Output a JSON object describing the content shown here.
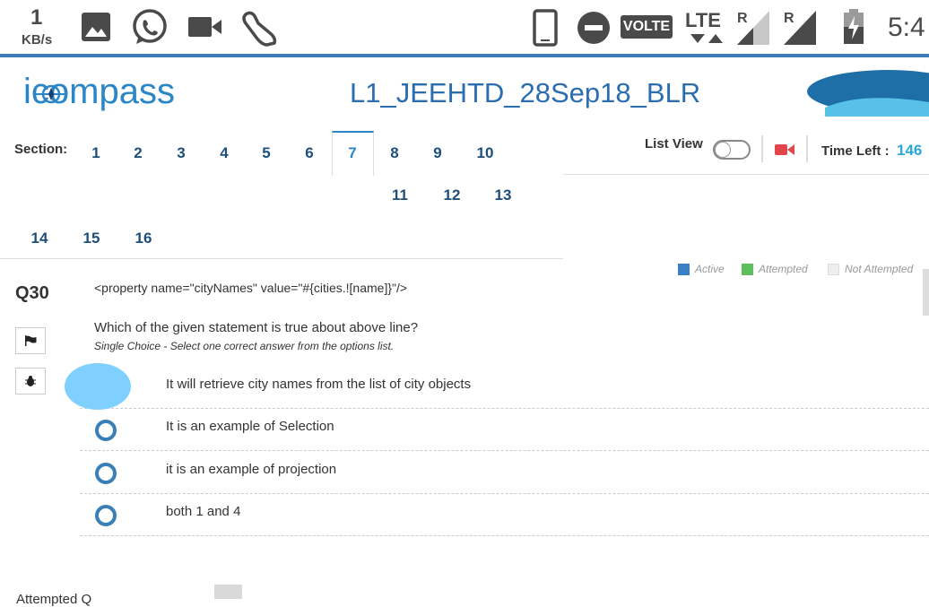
{
  "status_bar": {
    "speed_value": "1",
    "speed_unit": "KB/s",
    "volte": "VOLTE",
    "lte": "LTE",
    "r1": "R",
    "r2": "R",
    "clock": "5:4",
    "icons": [
      "gallery-icon",
      "whatsapp-icon",
      "video-call-icon",
      "shoe-icon",
      "phone-rotate-icon",
      "do-not-disturb-icon",
      "signal-icon",
      "battery-icon"
    ]
  },
  "header": {
    "logo": "icompass",
    "title": "L1_JEEHTD_28Sep18_BLR"
  },
  "sections": {
    "label": "Section:",
    "row1": [
      "1",
      "2",
      "3",
      "4",
      "5",
      "6",
      "7",
      "8",
      "9",
      "10"
    ],
    "row2": [
      "11",
      "12",
      "13"
    ],
    "row3": [
      "14",
      "15",
      "16"
    ],
    "active": "7"
  },
  "toolbar": {
    "list_view": "List View",
    "time_left_label": "Time Left :",
    "time_left_value": "146"
  },
  "legend": {
    "active": "Active",
    "attempted": "Attempted",
    "not_attempted": "Not Attempted",
    "colors": {
      "active": "#3a7fc4",
      "attempted": "#5cbf5c",
      "not_attempted": "#eeeeee"
    }
  },
  "question": {
    "number": "Q30",
    "code": "<property name=\"cityNames\" value=\"#{cities.![name]}\"/>",
    "text": "Which of the given statement is true about above line?",
    "hint": "Single Choice - Select one correct answer from the options list.",
    "options": [
      "It will retrieve city names from the list of city objects",
      "It is an example of Selection",
      "it is an example of projection",
      "both 1 and 4"
    ]
  },
  "footer": {
    "partial_text": "Attempted Q"
  }
}
